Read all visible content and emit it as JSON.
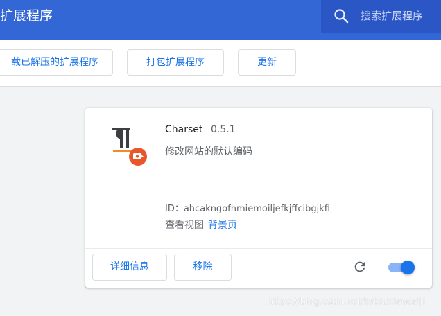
{
  "header": {
    "title": "扩展程序",
    "search_placeholder": "搜索扩展程序",
    "background_color": "#3367d6"
  },
  "toolbar": {
    "load_unpacked_label": "载已解压的扩展程序",
    "pack_label": "打包扩展程序",
    "update_label": "更新"
  },
  "extension": {
    "name": "Charset",
    "version": "0.5.1",
    "description": "修改网站的默认编码",
    "id_line": "ID：ahcakngofhmiemoiljefkjffcibgjkfi",
    "inspect_views_label": "查看视图",
    "background_page_link": "背景页",
    "details_label": "详细信息",
    "remove_label": "移除",
    "enabled": true,
    "icon": "pilcrow-charset-icon"
  },
  "watermark": "https://blog.csdn.net/tutouxiaocaiji"
}
